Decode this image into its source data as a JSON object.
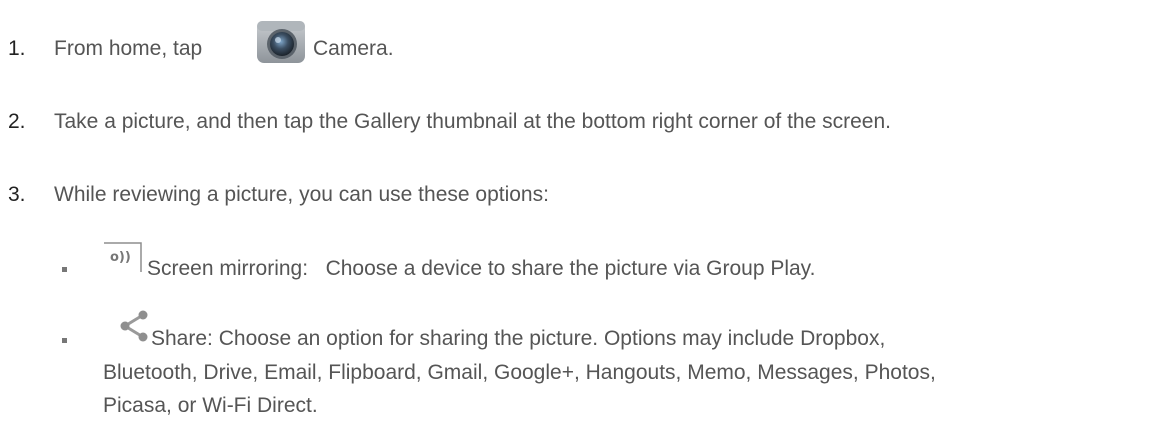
{
  "steps": [
    {
      "number": "1.",
      "before": "From home, tap ",
      "icon": "camera-app-icon",
      "after": " Camera."
    },
    {
      "number": "2.",
      "text": "Take a picture, and then tap the Gallery thumbnail at the bottom right corner of the screen."
    },
    {
      "number": "3.",
      "text": "While reviewing a picture, you can use these options:"
    }
  ],
  "options": [
    {
      "icon": "screen-mirroring-icon",
      "label": "Screen mirroring:",
      "description": "Choose a device to share the picture via Group Play."
    },
    {
      "icon": "share-icon",
      "label": "Share",
      "separator": ":",
      "description_lines": [
        "Choose an option for sharing the picture. Options may include Dropbox,",
        "Bluetooth, Drive, Email, Flipboard, Gmail, Google+, Hangouts, Memo, Messages, Photos,",
        "Picasa, or Wi-Fi Direct."
      ]
    }
  ],
  "colors": {
    "text": "#555555",
    "number": "#222222",
    "bullet": "#777777"
  }
}
